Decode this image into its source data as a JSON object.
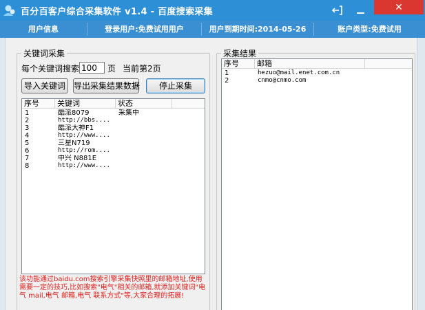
{
  "window": {
    "title": "百分百客户综合采集软件 v1.4 - 百度搜索采集",
    "close_glyph": "✕",
    "exit_icon": "exit-icon"
  },
  "infobar": {
    "user_info": "用户信息",
    "login_user": "登录用户:免费试用用户",
    "expire": "用户到期时间:2014-05-26",
    "account_type": "账户类型:免费试用"
  },
  "keyword_panel": {
    "legend": "关键词采集",
    "per_keyword_label": "每个关键词搜索:",
    "pages_value": "100",
    "pages_unit": "页",
    "current_page": "当前第2页",
    "import_button": "导入关键词",
    "export_button": "导出采集结果数据",
    "stop_button": "停止采集",
    "columns": [
      "序号",
      "关键词",
      "状态"
    ],
    "rows": [
      {
        "no": "1",
        "keyword": "酷派8079",
        "status": "采集中"
      },
      {
        "no": "2",
        "keyword": "http://bbs....",
        "status": ""
      },
      {
        "no": "3",
        "keyword": "酷派大神F1",
        "status": ""
      },
      {
        "no": "4",
        "keyword": "http://www....",
        "status": ""
      },
      {
        "no": "5",
        "keyword": "三星N719",
        "status": ""
      },
      {
        "no": "6",
        "keyword": "http://rom....",
        "status": ""
      },
      {
        "no": "7",
        "keyword": "中兴 N881E",
        "status": ""
      },
      {
        "no": "8",
        "keyword": "http://www....",
        "status": ""
      }
    ],
    "notice": "该功能通过baidu.com搜索引擎采集快照里的邮箱地址,使用需要一定的技巧,比如搜索\"电气\"相关的邮箱,就添加关键词\"电气 mail,电气 邮箱,电气 联系方式\"等,大家合理的拓展!"
  },
  "result_panel": {
    "legend": "采集结果",
    "columns": [
      "序号",
      "邮箱"
    ],
    "rows": [
      {
        "no": "1",
        "email": "hezuo@mail.enet.com.cn"
      },
      {
        "no": "2",
        "email": "cnmo@cnmo.com"
      }
    ]
  }
}
